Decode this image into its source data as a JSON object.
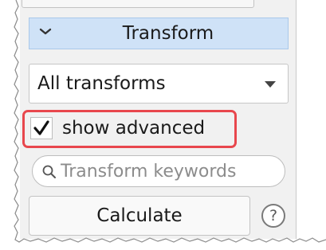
{
  "transform_panel": {
    "header": {
      "title": "Transform",
      "collapse_icon": "chevron-down-icon"
    },
    "filter_dropdown": {
      "selected": "All transforms",
      "caret_icon": "caret-down-icon"
    },
    "show_advanced": {
      "label": "show advanced",
      "checked": true,
      "check_icon": "checkmark-icon"
    },
    "search": {
      "value": "",
      "placeholder": "Transform keywords",
      "icon": "search-icon"
    },
    "calculate_label": "Calculate",
    "help_label": "?"
  },
  "colors": {
    "header_bg": "#cfe2f7",
    "header_border": "#a9c8ea",
    "panel_bg": "#f1f1f1",
    "highlight": "#e8474d"
  }
}
